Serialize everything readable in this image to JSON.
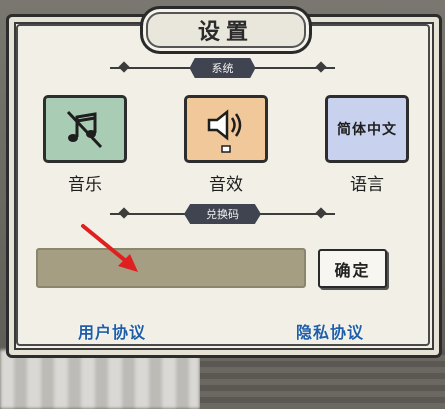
{
  "dialog": {
    "title": "设置"
  },
  "sections": {
    "system": "系统",
    "redeem": "兑换码"
  },
  "system_items": [
    {
      "label": "音乐",
      "icon": "music-muted-icon",
      "color": "#a9ccb4"
    },
    {
      "label": "音效",
      "icon": "speaker-icon",
      "color": "#f0c89a"
    },
    {
      "label": "语言",
      "icon_text": "简体中文",
      "color": "#c8d2ee"
    }
  ],
  "redeem": {
    "input_value": "",
    "confirm_label": "确定"
  },
  "links": {
    "user_agreement": "用户协议",
    "privacy_agreement": "隐私协议"
  },
  "colors": {
    "link": "#1f5fa8",
    "banner": "#3f4450",
    "arrow": "#e02020"
  }
}
